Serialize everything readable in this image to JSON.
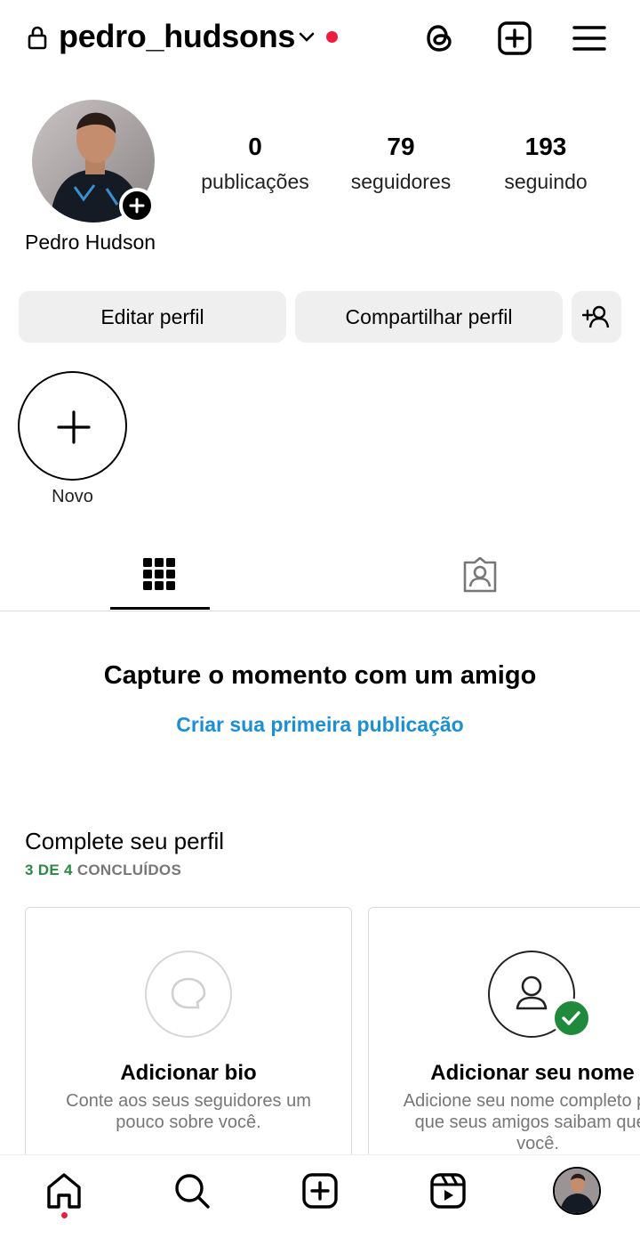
{
  "header": {
    "username": "pedro_hudsons",
    "icons": [
      "lock-icon",
      "chevron-down-icon",
      "threads-icon",
      "create-post-icon",
      "menu-icon"
    ],
    "notification_color": "#ed1d3d"
  },
  "profile": {
    "display_name": "Pedro Hudson",
    "stats": [
      {
        "value": "0",
        "label": "publicações"
      },
      {
        "value": "79",
        "label": "seguidores"
      },
      {
        "value": "193",
        "label": "seguindo"
      }
    ]
  },
  "actions": {
    "edit_label": "Editar perfil",
    "share_label": "Compartilhar perfil"
  },
  "highlights": {
    "new_label": "Novo"
  },
  "tabs": {
    "active": "grid",
    "items": [
      "grid-icon",
      "tagged-icon"
    ]
  },
  "empty_state": {
    "title": "Capture o momento com um amigo",
    "link": "Criar sua primeira publicação",
    "link_color": "#1a8fd6"
  },
  "complete_profile": {
    "title": "Complete seu perfil",
    "progress_done": "3 DE 4",
    "progress_label": "CONCLUÍDOS",
    "progress_color": "#2a8a45",
    "cards": [
      {
        "title": "Adicionar bio",
        "description": "Conte aos seus seguidores um pouco sobre você.",
        "completed": false
      },
      {
        "title": "Adicionar seu nome",
        "description": "Adicione seu nome completo para que seus amigos saibam que é você.",
        "completed": true
      }
    ]
  },
  "bottom_nav": {
    "items": [
      "home-icon",
      "search-icon",
      "create-icon",
      "reels-icon",
      "profile-avatar"
    ],
    "active": "home"
  }
}
